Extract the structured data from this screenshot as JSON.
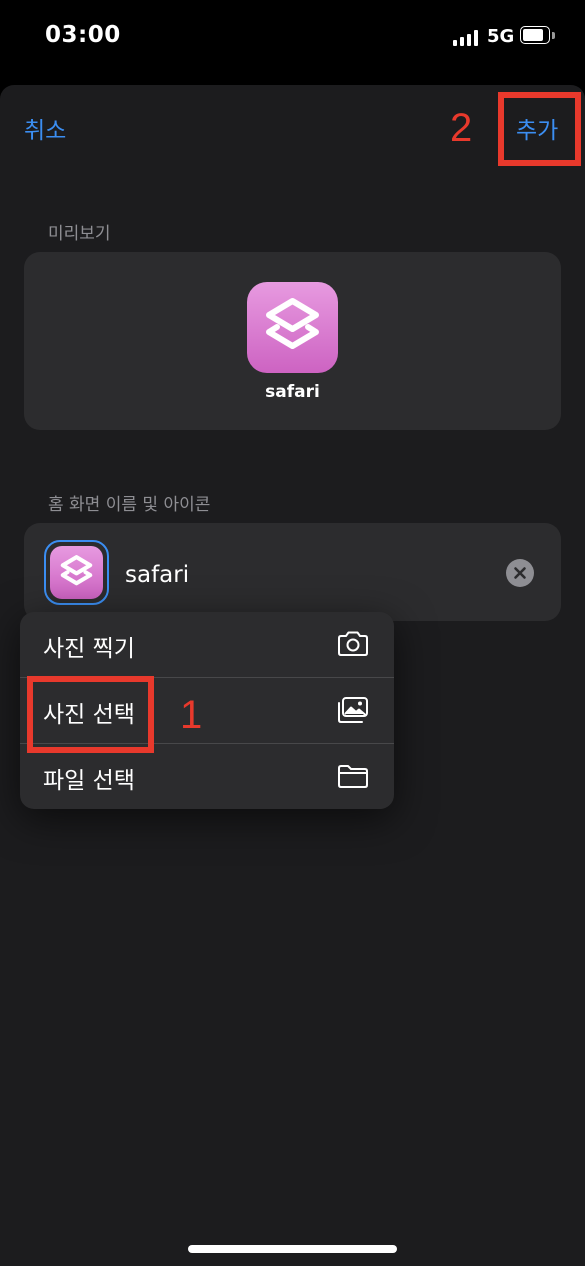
{
  "status_bar": {
    "time": "03:00",
    "network": "5G"
  },
  "nav": {
    "cancel_label": "취소",
    "add_label": "추가"
  },
  "preview": {
    "section_label": "미리보기",
    "app_name": "safari",
    "icon": "shortcuts-layers-icon"
  },
  "home_screen": {
    "section_label": "홈 화면 이름 및 아이콘",
    "name_value": "safari",
    "clear_icon": "clear-x-icon"
  },
  "menu": {
    "items": [
      {
        "label": "사진 찍기",
        "icon": "camera-icon"
      },
      {
        "label": "사진 선택",
        "icon": "photos-icon"
      },
      {
        "label": "파일 선택",
        "icon": "folder-icon"
      }
    ]
  },
  "annotations": {
    "step_1": "1",
    "step_2": "2",
    "color": "#e8392c"
  },
  "colors": {
    "accent": "#3b8ef2",
    "sheet_bg": "#1c1c1e",
    "card_bg": "#2c2c2e",
    "icon_pink": "#d96fd0"
  }
}
